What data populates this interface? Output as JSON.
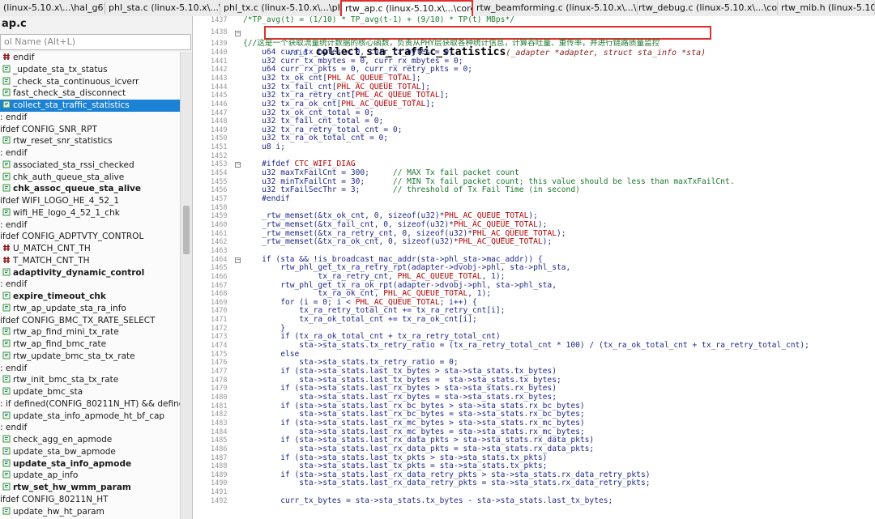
{
  "tabs": [
    {
      "label": "(linux-5.10.x\\...\\hal_g6)",
      "active": false
    },
    {
      "label": "phl_sta.c (linux-5.10.x\\...\\phl)",
      "active": false
    },
    {
      "label": "phl_tx.c (linux-5.10.x\\...\\phl)",
      "active": false
    },
    {
      "label": "rtw_ap.c (linux-5.10.x\\...\\core)",
      "active": true
    },
    {
      "label": "rtw_beamforming.c (linux-5.10.x\\...\\core)",
      "active": false
    },
    {
      "label": "rtw_debug.c (linux-5.10.x\\...\\core)",
      "active": false
    },
    {
      "label": "rtw_mib.h (linux-5.10.x\\...",
      "active": false
    }
  ],
  "left_panel": {
    "file_title": "ap.c",
    "symbol_input_placeholder": "ol Name (Alt+L)",
    "symbols": [
      {
        "label": "endif",
        "kind": "hash",
        "bold": false
      },
      {
        "label": "_update_sta_tx_status",
        "kind": "func",
        "bold": false
      },
      {
        "label": "_check_sta_continuous_icverr",
        "kind": "func",
        "bold": false
      },
      {
        "label": "fast_check_sta_disconnect",
        "kind": "func",
        "bold": false
      },
      {
        "label": "collect_sta_traffic_statistics",
        "kind": "func",
        "bold": false,
        "selected": true
      },
      {
        "label": ": endif",
        "kind": "none",
        "bold": false
      },
      {
        "label": "ifdef CONFIG_SNR_RPT",
        "kind": "none",
        "bold": false
      },
      {
        "label": "rtw_reset_snr_statistics",
        "kind": "func",
        "bold": false
      },
      {
        "label": ": endif",
        "kind": "none",
        "bold": false
      },
      {
        "label": "associated_sta_rssi_checked",
        "kind": "func",
        "bold": false
      },
      {
        "label": "chk_auth_queue_sta_alive",
        "kind": "func",
        "bold": false
      },
      {
        "label": "chk_assoc_queue_sta_alive",
        "kind": "func",
        "bold": true
      },
      {
        "label": "ifdef WIFI_LOGO_HE_4_52_1",
        "kind": "none",
        "bold": false
      },
      {
        "label": "wifi_HE_logo_4_52_1_chk",
        "kind": "func",
        "bold": false
      },
      {
        "label": ": endif",
        "kind": "none",
        "bold": false
      },
      {
        "label": "ifdef CONFIG_ADPTVTY_CONTROL",
        "kind": "none",
        "bold": false
      },
      {
        "label": "U_MATCH_CNT_TH",
        "kind": "hash",
        "bold": false
      },
      {
        "label": "T_MATCH_CNT_TH",
        "kind": "hash",
        "bold": false
      },
      {
        "label": "adaptivity_dynamic_control",
        "kind": "func",
        "bold": true
      },
      {
        "label": ": endif",
        "kind": "none",
        "bold": false
      },
      {
        "label": "expire_timeout_chk",
        "kind": "func",
        "bold": true
      },
      {
        "label": "rtw_ap_update_sta_ra_info",
        "kind": "func",
        "bold": false
      },
      {
        "label": "ifdef CONFIG_BMC_TX_RATE_SELECT",
        "kind": "none",
        "bold": false
      },
      {
        "label": "rtw_ap_find_mini_tx_rate",
        "kind": "func",
        "bold": false
      },
      {
        "label": "rtw_ap_find_bmc_rate",
        "kind": "func",
        "bold": false
      },
      {
        "label": "rtw_update_bmc_sta_tx_rate",
        "kind": "func",
        "bold": false
      },
      {
        "label": ": endif",
        "kind": "none",
        "bold": false
      },
      {
        "label": "rtw_init_bmc_sta_tx_rate",
        "kind": "func",
        "bold": false
      },
      {
        "label": "update_bmc_sta",
        "kind": "func",
        "bold": false
      },
      {
        "label": ": if defined(CONFIG_80211N_HT) && defined(C",
        "kind": "none",
        "bold": false
      },
      {
        "label": "update_sta_info_apmode_ht_bf_cap",
        "kind": "func",
        "bold": false
      },
      {
        "label": ": endif",
        "kind": "none",
        "bold": false
      },
      {
        "label": "check_agg_en_apmode",
        "kind": "func",
        "bold": false
      },
      {
        "label": "update_sta_bw_apmode",
        "kind": "func",
        "bold": false
      },
      {
        "label": "update_sta_info_apmode",
        "kind": "func",
        "bold": true
      },
      {
        "label": "update_ap_info",
        "kind": "func",
        "bold": false
      },
      {
        "label": "rtw_set_hw_wmm_param",
        "kind": "func",
        "bold": true
      },
      {
        "label": "ifdef CONFIG_80211N_HT",
        "kind": "none",
        "bold": false
      },
      {
        "label": "update_hw_ht_param",
        "kind": "func",
        "bold": false
      }
    ]
  },
  "signature": {
    "line_no": "1438",
    "void_kw": "void",
    "name": "collect_sta_traffic_statistics",
    "params": "(_adapter *adapter, struct sta_info *sta)"
  },
  "code_lines": [
    {
      "n": "1437",
      "t": "/*TP_avg(t) = (1/10) * TP_avg(t-1) + (9/10) * TP(t) MBps*/",
      "c": "cmt"
    },
    {
      "n": "1439",
      "t": "{//这是一个获取流量统计数据的核心函数，负责从PHY层获取各种统计信息，计算吞吐量、重传率，并进行链路质量监控",
      "c": "cmt"
    },
    {
      "n": "1440",
      "t": "    u64 curr_tx_bytes = 0, curr_rx_bytes = 0;"
    },
    {
      "n": "1441",
      "t": "    u32 curr_tx_mbytes = 0, curr_rx_mbytes = 0;"
    },
    {
      "n": "1442",
      "t": "    u64 curr_rx_pkts = 0, curr_rx_retry_pkts = 0;"
    },
    {
      "n": "1443",
      "t": "    u32 tx_ok_cnt[PHL_AC_QUEUE_TOTAL];"
    },
    {
      "n": "1444",
      "t": "    u32 tx_fail_cnt[PHL_AC_QUEUE_TOTAL];"
    },
    {
      "n": "1445",
      "t": "    u32 tx_ra_retry_cnt[PHL_AC_QUEUE_TOTAL];"
    },
    {
      "n": "1446",
      "t": "    u32 tx_ra_ok_cnt[PHL_AC_QUEUE_TOTAL];"
    },
    {
      "n": "1447",
      "t": "    u32 tx_ok_cnt_total = 0;"
    },
    {
      "n": "1448",
      "t": "    u32 tx_fail_cnt_total = 0;"
    },
    {
      "n": "1449",
      "t": "    u32 tx_ra_retry_total_cnt = 0;"
    },
    {
      "n": "1450",
      "t": "    u32 tx_ra_ok_total_cnt = 0;"
    },
    {
      "n": "1451",
      "t": "    u8 i;"
    },
    {
      "n": "1452",
      "t": ""
    },
    {
      "n": "1453",
      "t": "    #ifdef CTC_WIFI_DIAG"
    },
    {
      "n": "1454",
      "t": "    u32 maxTxFailCnt = 300;     // MAX Tx fail packet count"
    },
    {
      "n": "1455",
      "t": "    u32 minTxFailCnt = 30;      // MIN Tx fail packet count; this value should be less than maxTxFailCnt."
    },
    {
      "n": "1456",
      "t": "    u32 txFailSecThr = 3;       // threshold of Tx Fail Time (in second)"
    },
    {
      "n": "1457",
      "t": "    #endif"
    },
    {
      "n": "1458",
      "t": ""
    },
    {
      "n": "1459",
      "t": "    _rtw_memset(&tx_ok_cnt, 0, sizeof(u32)*PHL_AC_QUEUE_TOTAL);"
    },
    {
      "n": "1460",
      "t": "    _rtw_memset(&tx_fail_cnt, 0, sizeof(u32)*PHL_AC_QUEUE_TOTAL);"
    },
    {
      "n": "1461",
      "t": "    _rtw_memset(&tx_ra_retry_cnt, 0, sizeof(u32)*PHL_AC_QUEUE_TOTAL);"
    },
    {
      "n": "1462",
      "t": "    _rtw_memset(&tx_ra_ok_cnt, 0, sizeof(u32)*PHL_AC_QUEUE_TOTAL);"
    },
    {
      "n": "1463",
      "t": ""
    },
    {
      "n": "1464",
      "t": "    if (sta && !is_broadcast_mac_addr(sta->phl_sta->mac_addr)) {"
    },
    {
      "n": "1465",
      "t": "        rtw_phl_get_tx_ra_retry_rpt(adapter->dvobj->phl, sta->phl_sta,"
    },
    {
      "n": "1466",
      "t": "                tx_ra_retry_cnt, PHL_AC_QUEUE_TOTAL, 1);"
    },
    {
      "n": "1467",
      "t": "        rtw_phl_get_tx_ra_ok_rpt(adapter->dvobj->phl, sta->phl_sta,"
    },
    {
      "n": "1468",
      "t": "                tx_ra_ok_cnt, PHL_AC_QUEUE_TOTAL, 1);"
    },
    {
      "n": "1469",
      "t": "        for (i = 0; i < PHL_AC_QUEUE_TOTAL; i++) {"
    },
    {
      "n": "1470",
      "t": "            tx_ra_retry_total_cnt += tx_ra_retry_cnt[i];"
    },
    {
      "n": "1471",
      "t": "            tx_ra_ok_total_cnt += tx_ra_ok_cnt[i];"
    },
    {
      "n": "1472",
      "t": "        }"
    },
    {
      "n": "1473",
      "t": "        if (tx_ra_ok_total_cnt + tx_ra_retry_total_cnt)"
    },
    {
      "n": "1474",
      "t": "            sta->sta_stats.tx_retry_ratio = (tx_ra_retry_total_cnt * 100) / (tx_ra_ok_total_cnt + tx_ra_retry_total_cnt);"
    },
    {
      "n": "1475",
      "t": "        else"
    },
    {
      "n": "1476",
      "t": "            sta->sta_stats.tx_retry_ratio = 0;"
    },
    {
      "n": "1477",
      "t": "        if (sta->sta_stats.last_tx_bytes > sta->sta_stats.tx_bytes)"
    },
    {
      "n": "1478",
      "t": "            sta->sta_stats.last_tx_bytes =  sta->sta_stats.tx_bytes;"
    },
    {
      "n": "1479",
      "t": "        if (sta->sta_stats.last_rx_bytes > sta->sta_stats.rx_bytes)"
    },
    {
      "n": "1480",
      "t": "            sta->sta_stats.last_rx_bytes = sta->sta_stats.rx_bytes;"
    },
    {
      "n": "1481",
      "t": "        if (sta->sta_stats.last_rx_bc_bytes > sta->sta_stats.rx_bc_bytes)"
    },
    {
      "n": "1482",
      "t": "            sta->sta_stats.last_rx_bc_bytes = sta->sta_stats.rx_bc_bytes;"
    },
    {
      "n": "1483",
      "t": "        if (sta->sta_stats.last_rx_mc_bytes > sta->sta_stats.rx_mc_bytes)"
    },
    {
      "n": "1484",
      "t": "            sta->sta_stats.last_rx_mc_bytes = sta->sta_stats.rx_mc_bytes;"
    },
    {
      "n": "1485",
      "t": "        if (sta->sta_stats.last_rx_data_pkts > sta->sta_stats.rx_data_pkts)"
    },
    {
      "n": "1486",
      "t": "            sta->sta_stats.last_rx_data_pkts = sta->sta_stats.rx_data_pkts;"
    },
    {
      "n": "1487",
      "t": "        if (sta->sta_stats.last_tx_pkts > sta->sta_stats.tx_pkts)"
    },
    {
      "n": "1488",
      "t": "            sta->sta_stats.last_tx_pkts = sta->sta_stats.tx_pkts;"
    },
    {
      "n": "1489",
      "t": "        if (sta->sta_stats.last_rx_data_retry_pkts > sta->sta_stats.rx_data_retry_pkts)"
    },
    {
      "n": "1490",
      "t": "            sta->sta_stats.last_rx_data_retry_pkts = sta->sta_stats.rx_data_retry_pkts;"
    },
    {
      "n": "1491",
      "t": ""
    },
    {
      "n": "1492",
      "t": "        curr_tx_bytes = sta->sta_stats.tx_bytes - sta->sta_stats.last_tx_bytes;"
    }
  ],
  "fold_lines": [
    "1438",
    "1453",
    "1464"
  ],
  "colors": {
    "highlight_red": "#e0302d",
    "selection_blue": "#1b82d6",
    "code_blue": "#1f2a8a",
    "comment_green": "#1c7a2f",
    "macro_red": "#b30000"
  }
}
